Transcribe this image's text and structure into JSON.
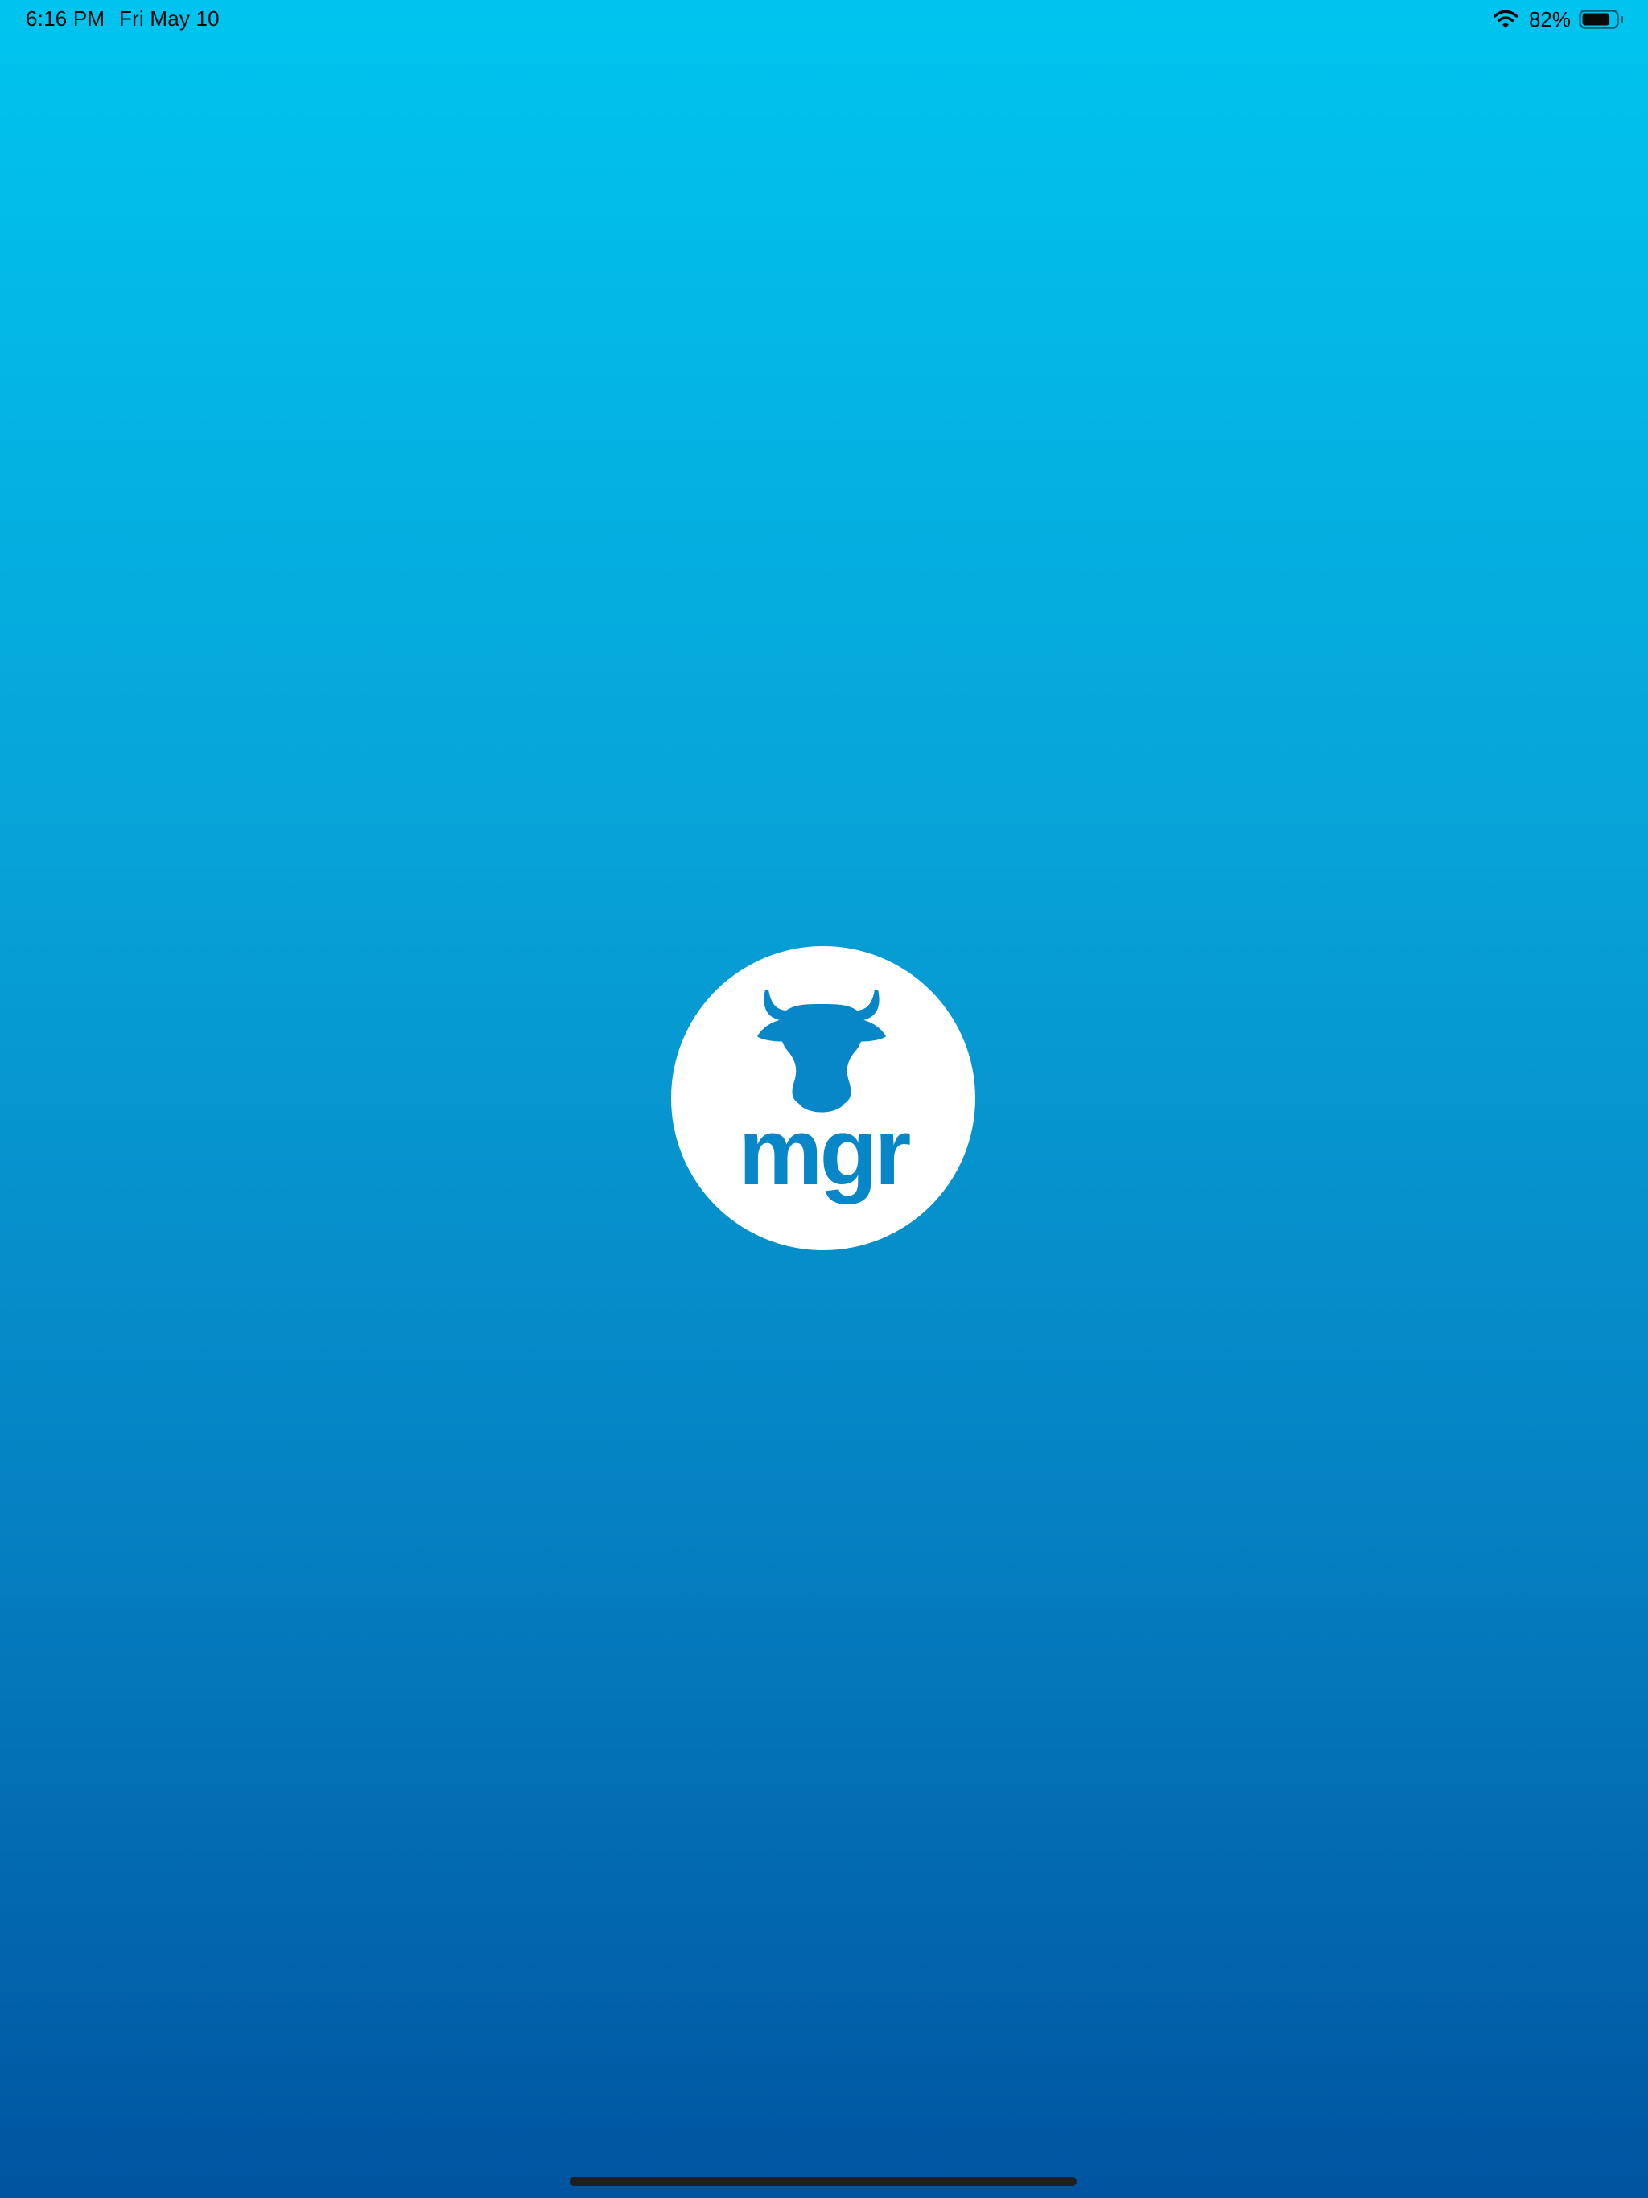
{
  "status_bar": {
    "time": "6:16 PM",
    "date": "Fri May 10",
    "battery_percent": "82%",
    "battery_level": 0.82,
    "icons": [
      "wifi-icon",
      "battery-icon"
    ]
  },
  "logo": {
    "wordmark": "mgr",
    "icon": "cow-head-icon",
    "brand_color": "#0786c8",
    "badge_color": "#ffffff"
  },
  "colors": {
    "background_top": "#00c4ef",
    "background_bottom": "#0054a0",
    "home_indicator": "#1f1f1f"
  }
}
